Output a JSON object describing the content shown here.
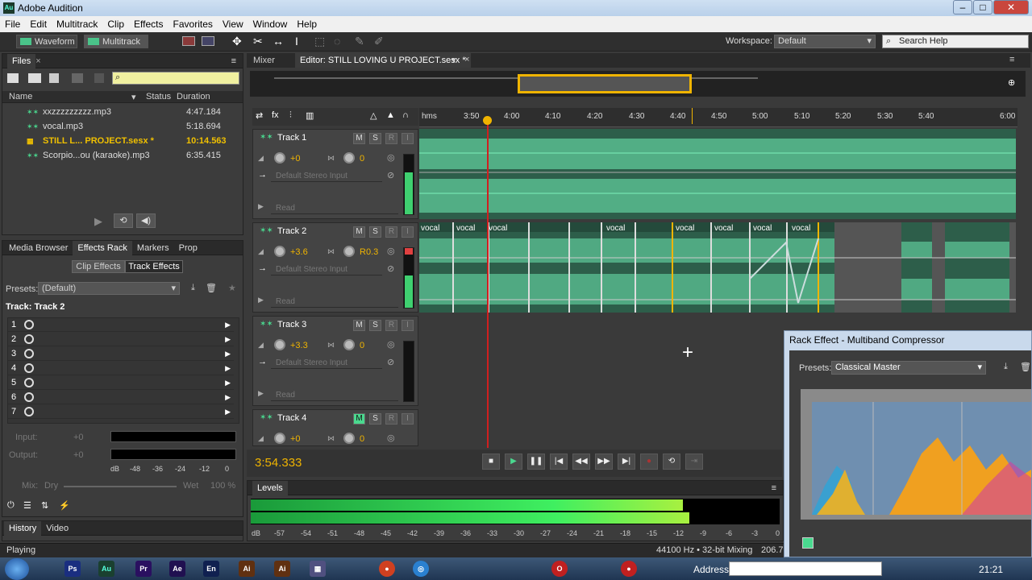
{
  "window": {
    "title": "Adobe Audition",
    "logo": "Au"
  },
  "menu": [
    "File",
    "Edit",
    "Multitrack",
    "Clip",
    "Effects",
    "Favorites",
    "View",
    "Window",
    "Help"
  ],
  "toolbar": {
    "waveform": "Waveform",
    "multitrack": "Multitrack",
    "workspace_label": "Workspace:",
    "workspace_value": "Default",
    "search_placeholder": "Search Help"
  },
  "files_panel": {
    "tab": "Files",
    "columns": [
      "Name",
      "Status",
      "Duration"
    ],
    "rows": [
      {
        "name": "xxzzzzzzzzz.mp3",
        "duration": "4:47.184"
      },
      {
        "name": "vocal.mp3",
        "duration": "5:18.694"
      },
      {
        "name": "STILL L... PROJECT.sesx *",
        "duration": "10:14.563"
      },
      {
        "name": "Scorpio...ou (karaoke).mp3",
        "duration": "6:35.415"
      }
    ]
  },
  "effects_panel": {
    "tabs": [
      "Media Browser",
      "Effects Rack",
      "Markers",
      "Prop"
    ],
    "subtabs": [
      "Clip Effects",
      "Track Effects"
    ],
    "presets_label": "Presets:",
    "presets_value": "(Default)",
    "track_label": "Track: Track 2",
    "slots": [
      "1",
      "2",
      "3",
      "4",
      "5",
      "6",
      "7"
    ],
    "input_label": "Input:",
    "input_val": "+0",
    "output_label": "Output:",
    "output_val": "+0",
    "mix_label": "Mix:",
    "dry": "Dry",
    "wet": "Wet",
    "wet_pct": "100 %",
    "scale": [
      "dB",
      "-48",
      "-36",
      "-24",
      "-12",
      "0"
    ]
  },
  "history_panel": {
    "tabs": [
      "History",
      "Video"
    ]
  },
  "editor": {
    "tabs": [
      "Mixer",
      "Editor: STILL LOVING U PROJECT.sesx *"
    ],
    "ruler": [
      "hms",
      "3:50",
      "4:00",
      "4:10",
      "4:20",
      "4:30",
      "4:40",
      "4:50",
      "5:00",
      "5:10",
      "5:20",
      "5:30",
      "5:40",
      "6:00"
    ],
    "time": "3:54.333",
    "tracks": [
      {
        "name": "Track 1",
        "vol": "+0",
        "pan": "0",
        "input": "Default Stereo Input",
        "mode": "Read"
      },
      {
        "name": "Track 2",
        "vol": "+3.6",
        "pan": "R0.3",
        "input": "Default Stereo Input",
        "mode": "Read"
      },
      {
        "name": "Track 3",
        "vol": "+3.3",
        "pan": "0",
        "input": "Default Stereo Input",
        "mode": "Read"
      },
      {
        "name": "Track 4",
        "vol": "+0",
        "pan": "0"
      }
    ],
    "msr": [
      "M",
      "S",
      "R",
      "I"
    ],
    "clips": [
      "vocal",
      "vocal",
      "vocal",
      "vocal",
      "vocal",
      "vocal",
      "vocal",
      "vocal"
    ]
  },
  "levels": {
    "title": "Levels",
    "scale": [
      "dB",
      "-57",
      "-54",
      "-51",
      "-48",
      "-45",
      "-42",
      "-39",
      "-36",
      "-33",
      "-30",
      "-27",
      "-24",
      "-21",
      "-18",
      "-15",
      "-12",
      "-9",
      "-6",
      "-3",
      "0"
    ]
  },
  "rack_effect": {
    "title": "Rack Effect - Multiband Compressor",
    "presets_label": "Presets:",
    "presets_value": "Classical Master"
  },
  "status": {
    "left": "Playing",
    "right": "44100 Hz • 32-bit Mixing",
    "extra": "206.7"
  },
  "taskbar": {
    "address_label": "Address",
    "clock": "21:21"
  },
  "colors": {
    "accent": "#f0b400",
    "wave": "#5fc99a",
    "playhead": "#d01f1f"
  }
}
